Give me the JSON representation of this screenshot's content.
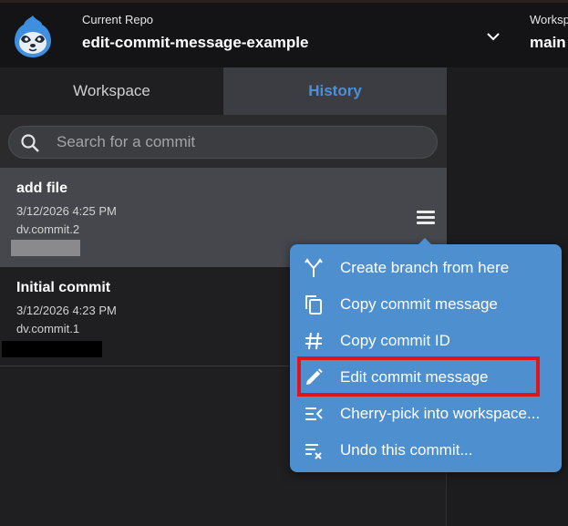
{
  "header": {
    "repo_label": "Current Repo",
    "repo_name": "edit-commit-message-example",
    "workspace_label": "Workspace",
    "workspace_name": "main"
  },
  "tabs": [
    {
      "label": "Workspace",
      "active": false
    },
    {
      "label": "History",
      "active": true
    }
  ],
  "search": {
    "placeholder": "Search for a commit",
    "value": ""
  },
  "commits": [
    {
      "title": "add file",
      "date": "3/12/2026 4:25 PM",
      "id": "dv.commit.2",
      "selected": true
    },
    {
      "title": "Initial commit",
      "date": "3/12/2026 4:23 PM",
      "id": "dv.commit.1",
      "selected": false
    }
  ],
  "context_menu": {
    "items": [
      {
        "label": "Create branch from here",
        "icon": "branch-icon"
      },
      {
        "label": "Copy commit message",
        "icon": "copy-icon"
      },
      {
        "label": "Copy commit ID",
        "icon": "hash-icon"
      },
      {
        "label": "Edit commit message",
        "icon": "pencil-icon",
        "highlighted": true
      },
      {
        "label": "Cherry-pick into workspace...",
        "icon": "cherry-pick-icon"
      },
      {
        "label": "Undo this commit...",
        "icon": "undo-list-icon"
      }
    ]
  },
  "colors": {
    "accent": "#4a8fd8",
    "menu_bg": "#4e8fd0",
    "highlight_border": "#e0141c",
    "selected_row": "#46474d"
  }
}
